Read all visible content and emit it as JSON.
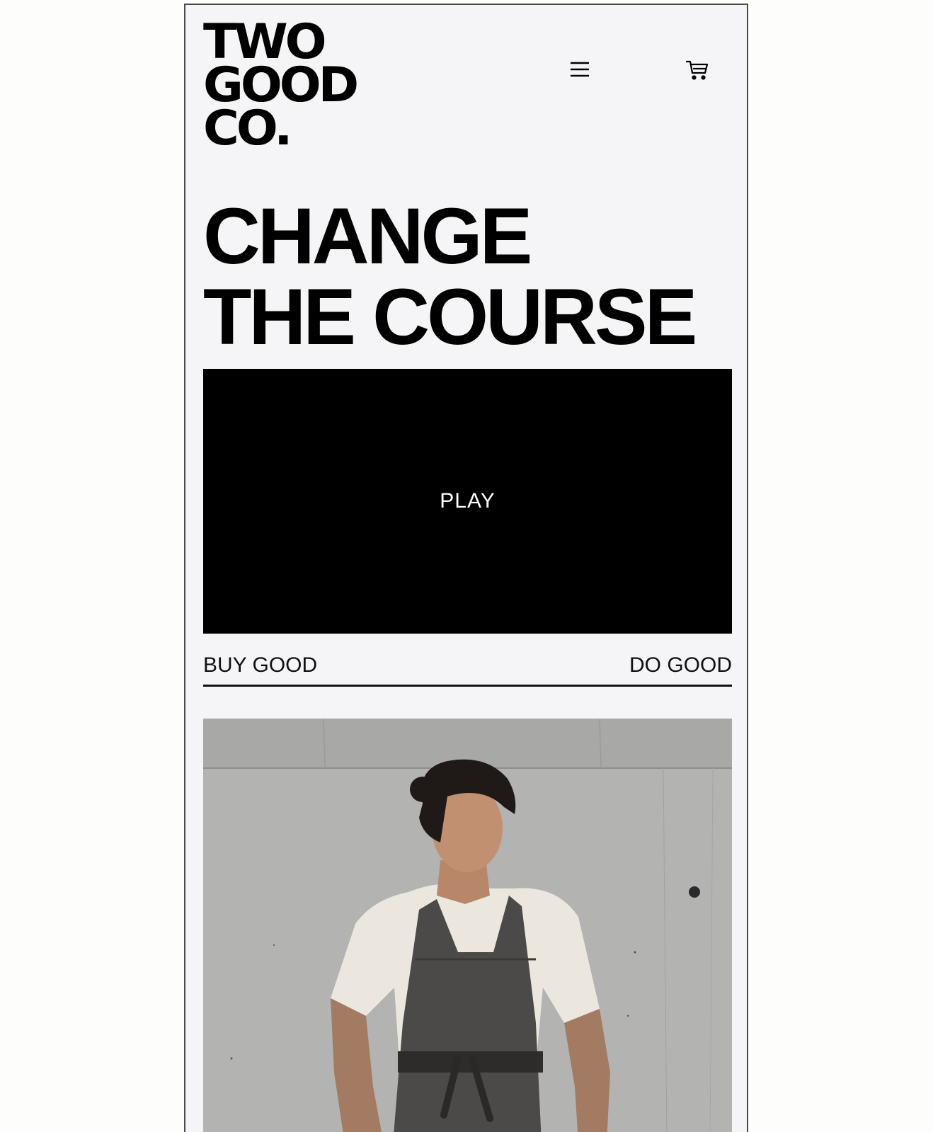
{
  "brand": {
    "logo_lines": [
      "TWO",
      "GOOD",
      "CO."
    ]
  },
  "header": {
    "menu_icon": "hamburger-menu-icon",
    "cart_icon": "cart-icon"
  },
  "hero": {
    "headline_lines": [
      "CHANGE",
      "THE COURSE"
    ]
  },
  "video": {
    "play_label": "PLAY"
  },
  "tabs": {
    "left_label": "BUY GOOD",
    "right_label": "DO GOOD"
  },
  "colors": {
    "page_background": "#f5f5f7",
    "text": "#000000",
    "video_background": "#000000",
    "accent_yellow": "#f7e27a"
  }
}
